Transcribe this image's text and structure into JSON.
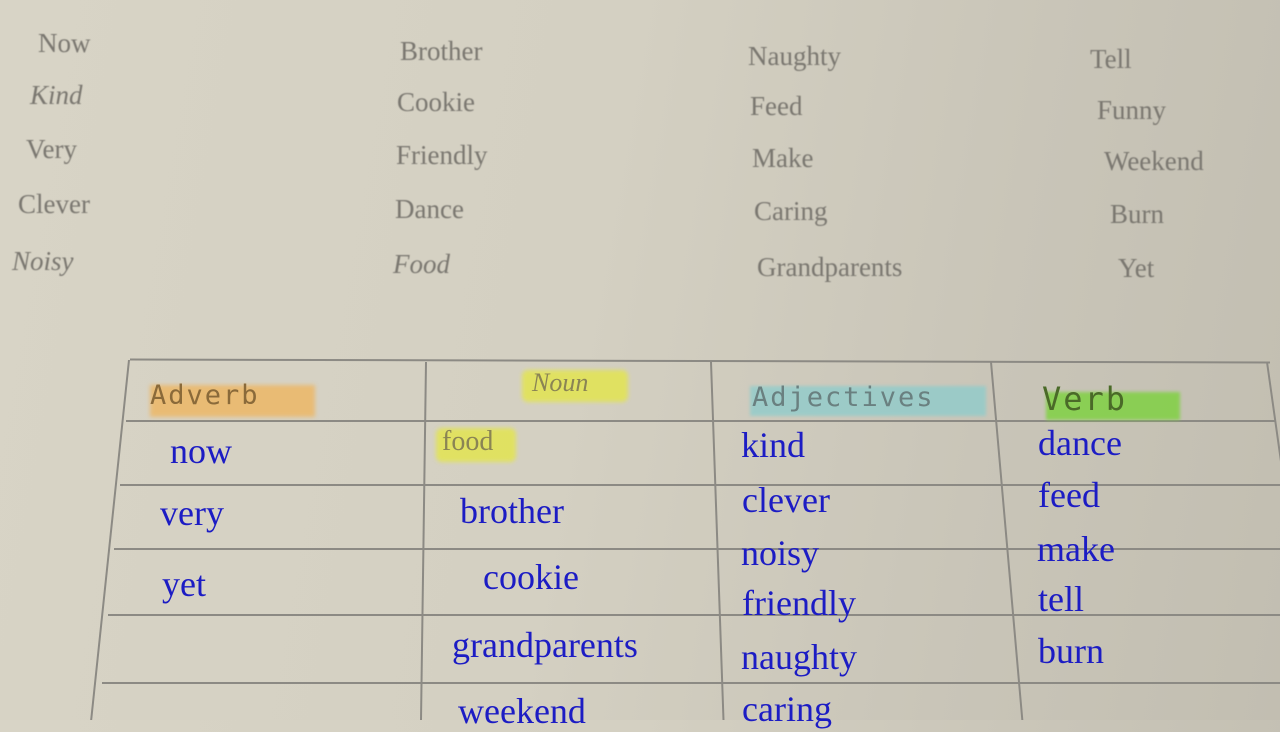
{
  "word_bank": {
    "col1": [
      "Now",
      "Kind",
      "Very",
      "Clever",
      "Noisy"
    ],
    "col2": [
      "Brother",
      "Cookie",
      "Friendly",
      "Dance",
      "Food"
    ],
    "col3": [
      "Naughty",
      "Feed",
      "Make",
      "Caring",
      "Grandparents"
    ],
    "col4": [
      "Tell",
      "Funny",
      "Weekend",
      "Burn",
      "Yet"
    ]
  },
  "table": {
    "headers": [
      {
        "label": "Adverb",
        "highlight": "#f0b45a"
      },
      {
        "label": "Noun",
        "highlight": "#e4e64a"
      },
      {
        "label": "Adjectives",
        "highlight": "#8ccccc"
      },
      {
        "label": "Verb",
        "highlight": "#7cd23c"
      }
    ],
    "adverb": [
      "now",
      "very",
      "yet"
    ],
    "noun_highlighted": "food",
    "noun": [
      "brother",
      "cookie",
      "grandparents",
      "weekend"
    ],
    "adjectives": [
      "kind",
      "clever",
      "noisy",
      "friendly",
      "naughty",
      "caring"
    ],
    "verb": [
      "dance",
      "feed",
      "make",
      "tell",
      "burn"
    ]
  }
}
